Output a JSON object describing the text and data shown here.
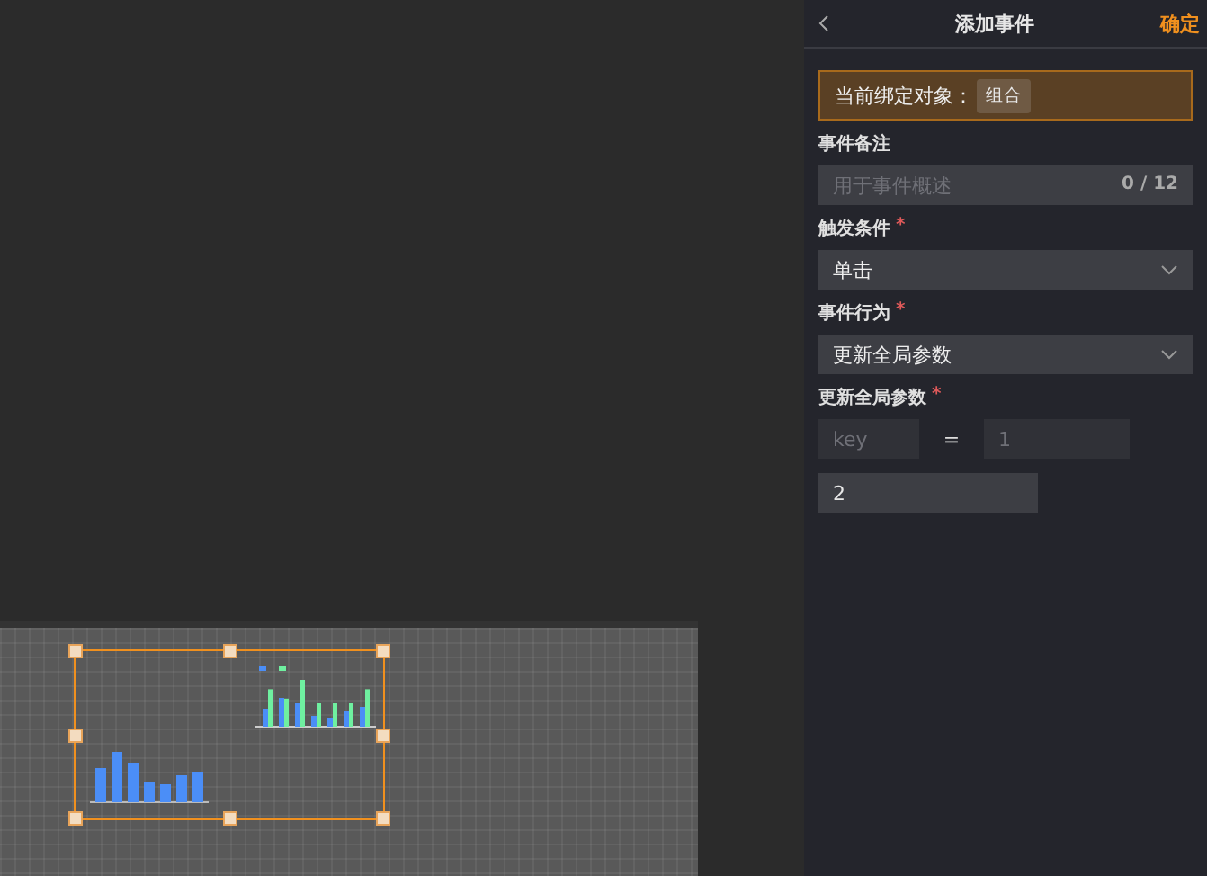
{
  "panel": {
    "title": "添加事件",
    "confirm": "确定"
  },
  "binding": {
    "label": "当前绑定对象：",
    "tag": "组合"
  },
  "fields": [
    {
      "kind": "input",
      "label": "事件备注",
      "placeholder": "用于事件概述",
      "counter": "0 / 12"
    },
    {
      "kind": "select",
      "label": "触发条件",
      "required_mark": "*",
      "value": "单击"
    },
    {
      "kind": "select",
      "label": "事件行为",
      "required_mark": "*",
      "value": "更新全局参数"
    },
    {
      "kind": "params",
      "label": "更新全局参数",
      "required_mark": "*",
      "key_placeholder": "key",
      "equals": "=",
      "value_placeholder": "1",
      "extra_value": "2"
    }
  ],
  "canvas": {
    "group": {
      "selected": true
    }
  }
}
